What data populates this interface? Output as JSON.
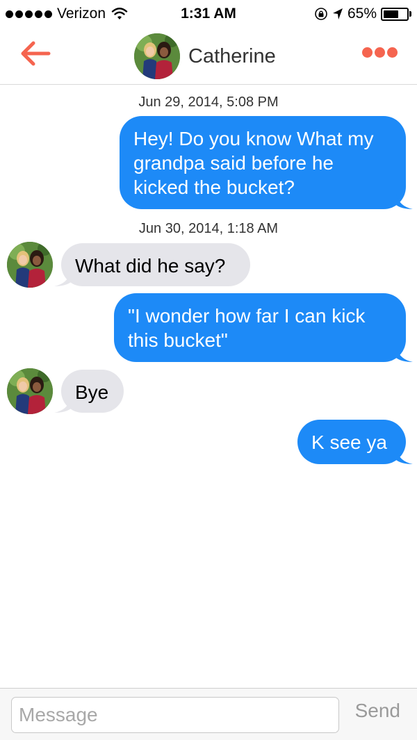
{
  "status_bar": {
    "carrier": "Verizon",
    "time": "1:31 AM",
    "battery": "65%",
    "battery_level": 0.65,
    "icons": [
      "signal-dots",
      "wifi-icon",
      "rotation-lock-icon",
      "location-arrow-icon",
      "battery-icon"
    ]
  },
  "nav": {
    "title": "Catherine",
    "back_icon": "arrow-left-icon",
    "more_icon": "ellipsis-icon",
    "accent_color": "#f5644f"
  },
  "conversation": {
    "timestamps": [
      "Jun 29, 2014, 5:08 PM",
      "Jun 30, 2014, 1:18 AM"
    ],
    "messages": [
      {
        "sender": "me",
        "lines": [
          "Hey! Do you know What my",
          "grandpa said before he",
          "kicked the bucket?"
        ]
      },
      {
        "sender": "Catherine",
        "lines": [
          "What did he say?"
        ]
      },
      {
        "sender": "me",
        "lines": [
          "\"I wonder how far I can kick",
          "this bucket\""
        ]
      },
      {
        "sender": "Catherine",
        "lines": [
          "Bye"
        ]
      },
      {
        "sender": "me",
        "lines": [
          "K see ya"
        ]
      }
    ],
    "outgoing_color": "#1d8af7",
    "incoming_color": "#e5e5ea"
  },
  "input": {
    "placeholder": "Message",
    "value": "",
    "send_label": "Send"
  }
}
